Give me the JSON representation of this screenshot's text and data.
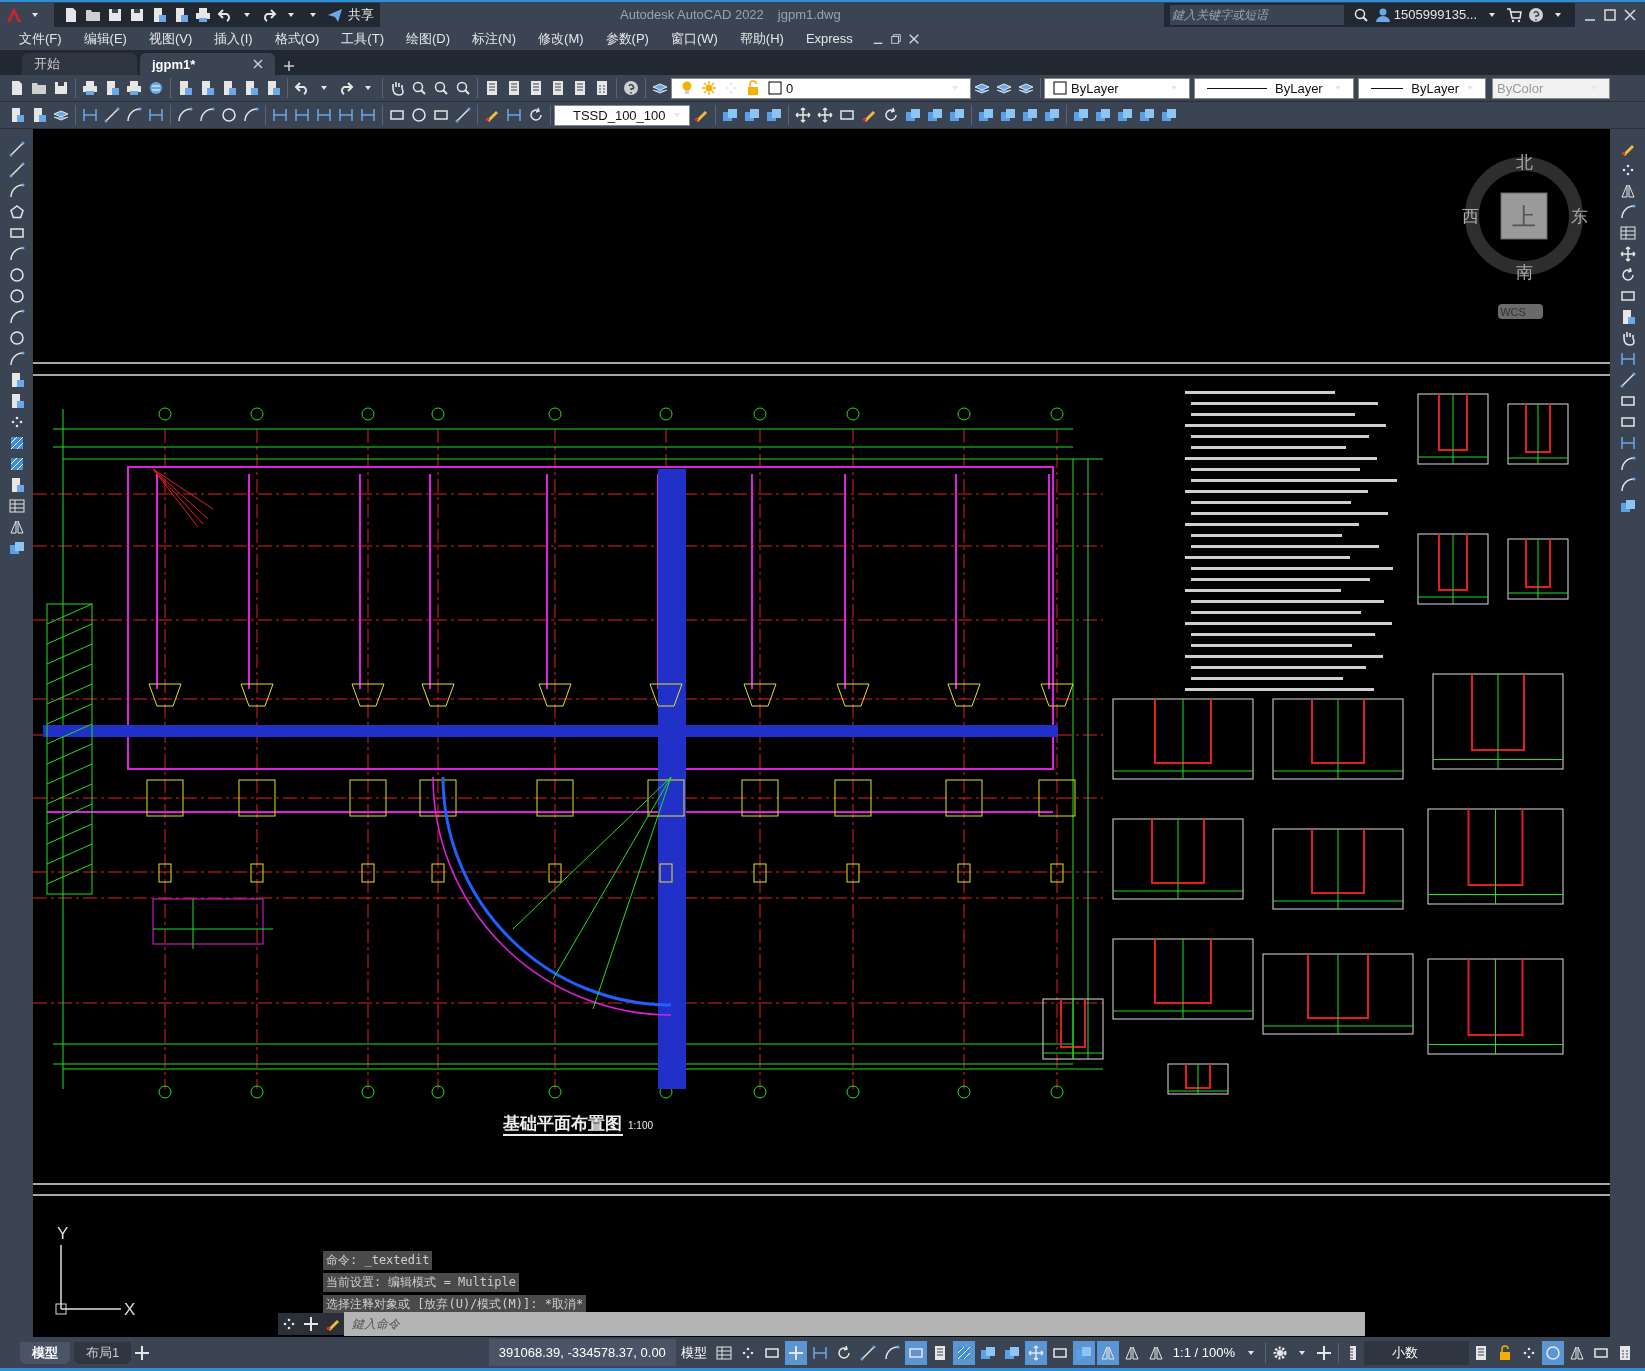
{
  "title_bar": {
    "share": "共享",
    "title": "Autodesk AutoCAD 2022",
    "filename": "jgpm1.dwg",
    "search": {
      "placeholder": "鍵入关键字或短语"
    },
    "user": "1505999135..."
  },
  "menu": [
    "文件(F)",
    "编辑(E)",
    "视图(V)",
    "插入(I)",
    "格式(O)",
    "工具(T)",
    "绘图(D)",
    "标注(N)",
    "修改(M)",
    "参数(P)",
    "窗口(W)",
    "帮助(H)",
    "Express"
  ],
  "file_tabs": [
    {
      "label": "开始",
      "selected": false
    },
    {
      "label": "jgpm1*",
      "selected": true
    }
  ],
  "properties": {
    "layer": "0",
    "color_setting": "ByLayer",
    "linetype": "ByLayer",
    "lineweight": "ByLayer",
    "plot_style": "ByColor",
    "dim_style": "TSSD_100_100"
  },
  "viewcube": {
    "north": "北",
    "south": "南",
    "east": "东",
    "west": "西",
    "face": "上",
    "ucs": "WCS"
  },
  "drawing": {
    "title": "基础平面布置图",
    "scale": "1:100"
  },
  "ucs_icon": {
    "x": "X",
    "y": "Y"
  },
  "command_history": [
    "命令: _textedit",
    "当前设置: 编辑模式 = Multiple",
    "选择注释对象或 [放弃(U)/模式(M)]: *取消*"
  ],
  "command_line": {
    "placeholder": "鍵入命令"
  },
  "layout_tabs": [
    {
      "label": "模型",
      "selected": true
    },
    {
      "label": "布局1",
      "selected": false
    }
  ],
  "status_bar": {
    "coordinates": "391068.39, -334578.37, 0.00",
    "space": "模型",
    "scale": "1:1 / 100%",
    "units": "小数",
    "toggles": [
      {
        "kind": "grid",
        "on": false
      },
      {
        "kind": "snap",
        "on": false
      },
      {
        "kind": "infer",
        "on": false
      },
      {
        "kind": "dynamic-input",
        "on": true
      },
      {
        "kind": "ortho",
        "on": false
      },
      {
        "kind": "polar",
        "on": false
      },
      {
        "kind": "isodraft",
        "on": false
      },
      {
        "kind": "angle",
        "on": false
      },
      {
        "kind": "osnap",
        "on": true
      },
      {
        "kind": "lineweight",
        "on": false
      },
      {
        "kind": "transparency",
        "on": true
      },
      {
        "kind": "cycling",
        "on": false
      },
      {
        "kind": "osnap3d",
        "on": false
      },
      {
        "kind": "ducs",
        "on": true
      },
      {
        "kind": "filter",
        "on": false
      },
      {
        "kind": "gizmo",
        "on": true
      },
      {
        "kind": "annovis",
        "on": true
      },
      {
        "kind": "autoscale",
        "on": false
      },
      {
        "kind": "annoscale",
        "on": false
      }
    ],
    "tools": [
      {
        "kind": "properties",
        "on": false
      },
      {
        "kind": "lock",
        "on": false
      },
      {
        "kind": "isolate",
        "on": false
      },
      {
        "kind": "hardware",
        "on": true
      },
      {
        "kind": "ucscheck"
      },
      {
        "kind": "fullscreen"
      },
      {
        "kind": "menu"
      }
    ]
  }
}
